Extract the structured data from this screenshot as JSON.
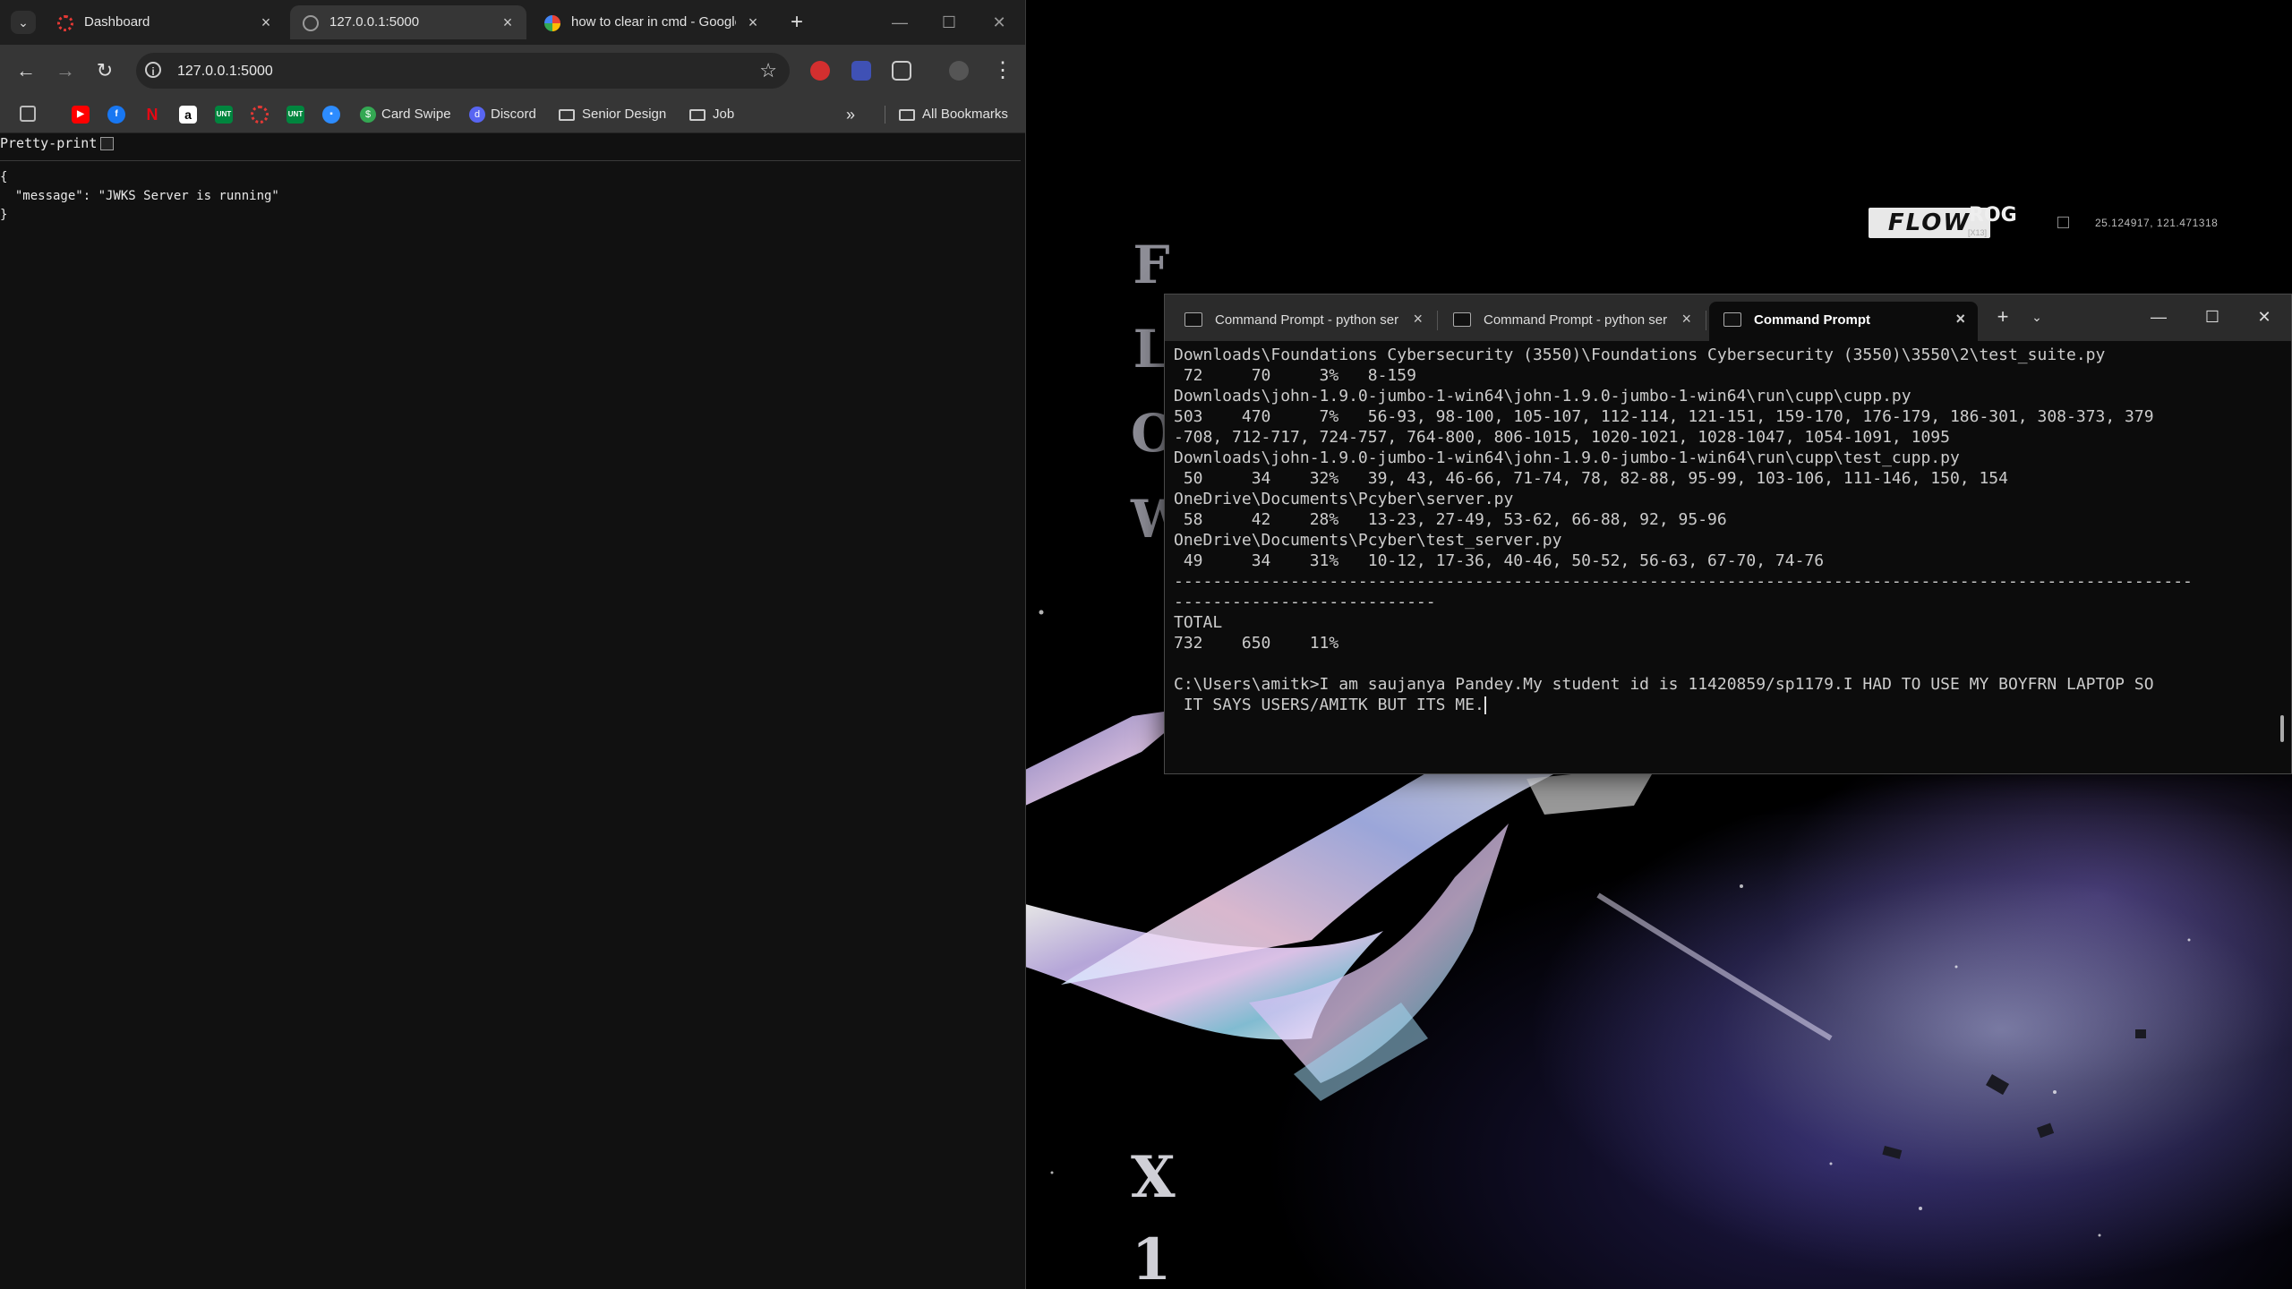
{
  "browser": {
    "tabs": [
      {
        "title": "Dashboard",
        "favicon": "red-dashboard-icon",
        "active": false
      },
      {
        "title": "127.0.0.1:5000",
        "favicon": "globe-icon",
        "active": true
      },
      {
        "title": "how to clear in cmd - Google Search",
        "favicon": "google-icon",
        "active": false
      }
    ],
    "address_bar": {
      "value": "127.0.0.1:5000"
    },
    "bookmarks": [
      {
        "label": "",
        "icon": "youtube-icon",
        "color": "#ff0000"
      },
      {
        "label": "",
        "icon": "facebook-icon",
        "color": "#1877f2"
      },
      {
        "label": "",
        "icon": "netflix-icon",
        "color": "#e50914"
      },
      {
        "label": "",
        "icon": "amazon-icon",
        "color": "#ffffff"
      },
      {
        "label": "",
        "icon": "unt-icon",
        "color": "#00853e"
      },
      {
        "label": "",
        "icon": "red-circle-icon",
        "color": "#e53935"
      },
      {
        "label": "",
        "icon": "unt-green-icon",
        "color": "#00853e"
      },
      {
        "label": "",
        "icon": "zoom-icon",
        "color": "#2d8cff"
      },
      {
        "label": "Card Swipe",
        "icon": "card-swipe-icon",
        "color": "#34a853"
      },
      {
        "label": "Discord",
        "icon": "discord-icon",
        "color": "#5865f2"
      },
      {
        "label": "Senior Design",
        "icon": "folder-icon"
      },
      {
        "label": "Job",
        "icon": "folder-icon"
      }
    ],
    "all_bookmarks_label": "All Bookmarks",
    "pretty_print_label": "Pretty-print",
    "json_lines": [
      "{",
      "  \"message\": \"JWKS Server is running\"",
      "}"
    ]
  },
  "desktop": {
    "flow_letters": [
      "F",
      "L",
      "O",
      "W"
    ],
    "x13_letters": [
      "X",
      "1"
    ],
    "flow_logo": "FLOW",
    "rog_logo": "ROG",
    "rog_sub": "[X13]",
    "coord_text": "25.124917, 121.471318"
  },
  "terminal": {
    "tabs": [
      {
        "title": "Command Prompt - python server.py",
        "active": false
      },
      {
        "title": "Command Prompt - python server.py",
        "active": false
      },
      {
        "title": "Command Prompt",
        "active": true
      }
    ],
    "lines": [
      "Downloads\\Foundations Cybersecurity (3550)\\Foundations Cybersecurity (3550)\\3550\\2\\test_suite.py",
      " 72     70     3%   8-159",
      "Downloads\\john-1.9.0-jumbo-1-win64\\john-1.9.0-jumbo-1-win64\\run\\cupp\\cupp.py",
      "503    470     7%   56-93, 98-100, 105-107, 112-114, 121-151, 159-170, 176-179, 186-301, 308-373, 379",
      "-708, 712-717, 724-757, 764-800, 806-1015, 1020-1021, 1028-1047, 1054-1091, 1095",
      "Downloads\\john-1.9.0-jumbo-1-win64\\john-1.9.0-jumbo-1-win64\\run\\cupp\\test_cupp.py",
      " 50     34    32%   39, 43, 46-66, 71-74, 78, 82-88, 95-99, 103-106, 111-146, 150, 154",
      "OneDrive\\Documents\\Pcyber\\server.py",
      " 58     42    28%   13-23, 27-49, 53-62, 66-88, 92, 95-96",
      "OneDrive\\Documents\\Pcyber\\test_server.py",
      " 49     34    31%   10-12, 17-36, 40-46, 50-52, 56-63, 67-70, 74-76",
      "---------------------------------------------------------------------------------------------------------",
      "---------------------------",
      "TOTAL",
      "732    650    11%",
      "",
      "C:\\Users\\amitk>I am saujanya Pandey.My student id is 11420859/sp1179.I HAD TO USE MY BOYFRN LAPTOP SO",
      " IT SAYS USERS/AMITK BUT ITS ME."
    ]
  }
}
